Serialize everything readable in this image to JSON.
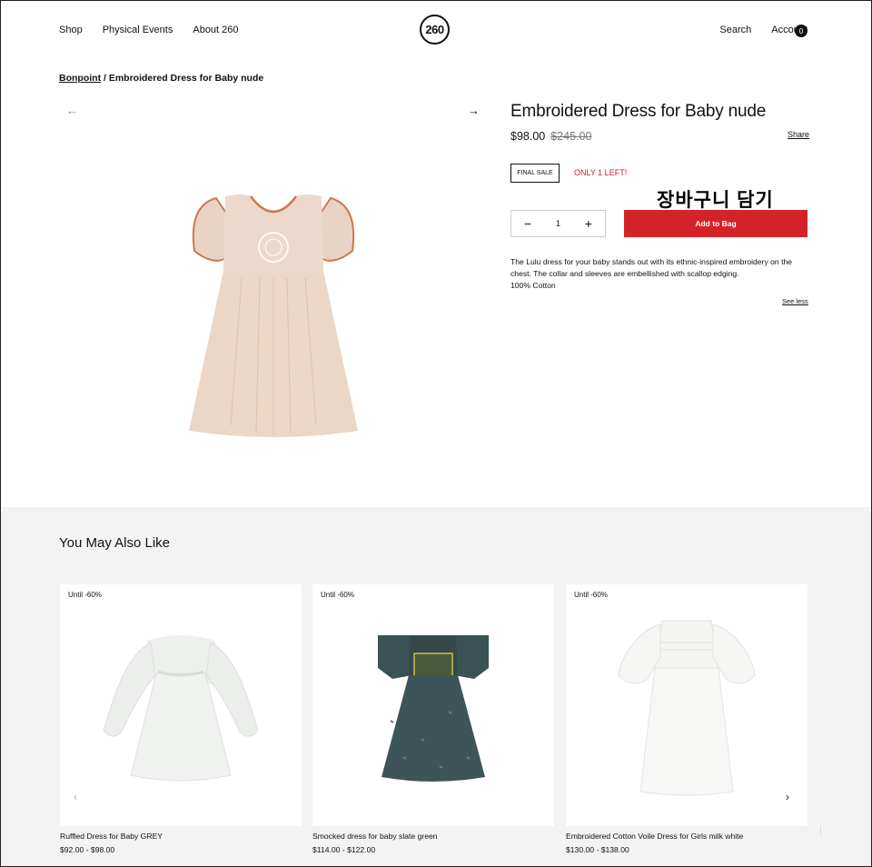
{
  "header": {
    "nav_left": [
      "Shop",
      "Physical Events",
      "About 260"
    ],
    "logo": "260",
    "nav_right": [
      "Search",
      "Account"
    ],
    "bag_count": "0"
  },
  "breadcrumb": {
    "brand": "Bonpoint",
    "sep": " / ",
    "current": "Embroidered Dress for Baby nude"
  },
  "gallery": {
    "prev_icon": "arrow-left-icon",
    "next_icon": "arrow-right-icon",
    "prev_glyph": "←",
    "next_glyph": "→"
  },
  "product": {
    "title": "Embroidered Dress for Baby nude",
    "price": "$98.00",
    "old_price": "$245.00",
    "share": "Share",
    "final_sale": "FINAL SALE",
    "stock": "ONLY 1 LEFT!",
    "overlay_ko": "장바구니 담기",
    "qty_minus": "−",
    "qty_value": "1",
    "qty_plus": "+",
    "add_to_bag": "Add to Bag",
    "description": [
      "The Lulu dress for your baby stands out with its ethnic-inspired embroidery on the",
      "chest. The collar and sleeves are embellished with scallop edging.",
      "100% Cotton"
    ],
    "see_less": "See less"
  },
  "recommendations": {
    "title": "You May Also Like",
    "prev_glyph": "‹",
    "next_glyph": "›",
    "items": [
      {
        "badge": "Until -60%",
        "name": "Ruffled Dress for Baby GREY",
        "price": "$92.00 - $98.00"
      },
      {
        "badge": "Until -60%",
        "name": "Smocked dress for baby slate green",
        "price": "$114.00 - $122.00"
      },
      {
        "badge": "Until -60%",
        "name": "Embroidered Cotton Voile Dress for Girls milk white",
        "price": "$130.00 - $138.00"
      }
    ]
  },
  "colors": {
    "accent_red": "#d42229",
    "stock_red": "#c8202a",
    "recs_bg": "#f3f3f3"
  }
}
